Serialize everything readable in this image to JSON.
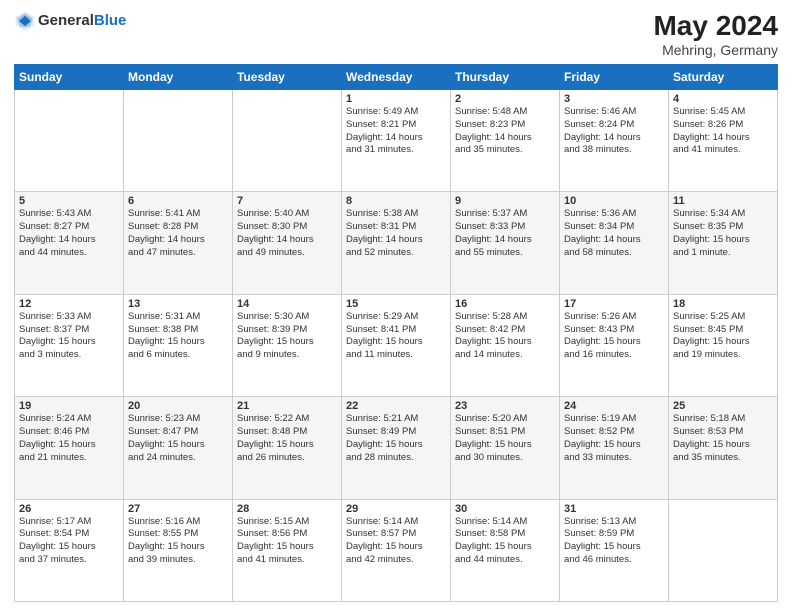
{
  "header": {
    "logo_general": "General",
    "logo_blue": "Blue",
    "month_year": "May 2024",
    "location": "Mehring, Germany"
  },
  "days_of_week": [
    "Sunday",
    "Monday",
    "Tuesday",
    "Wednesday",
    "Thursday",
    "Friday",
    "Saturday"
  ],
  "weeks": [
    [
      {
        "day": "",
        "info": ""
      },
      {
        "day": "",
        "info": ""
      },
      {
        "day": "",
        "info": ""
      },
      {
        "day": "1",
        "info": "Sunrise: 5:49 AM\nSunset: 8:21 PM\nDaylight: 14 hours\nand 31 minutes."
      },
      {
        "day": "2",
        "info": "Sunrise: 5:48 AM\nSunset: 8:23 PM\nDaylight: 14 hours\nand 35 minutes."
      },
      {
        "day": "3",
        "info": "Sunrise: 5:46 AM\nSunset: 8:24 PM\nDaylight: 14 hours\nand 38 minutes."
      },
      {
        "day": "4",
        "info": "Sunrise: 5:45 AM\nSunset: 8:26 PM\nDaylight: 14 hours\nand 41 minutes."
      }
    ],
    [
      {
        "day": "5",
        "info": "Sunrise: 5:43 AM\nSunset: 8:27 PM\nDaylight: 14 hours\nand 44 minutes."
      },
      {
        "day": "6",
        "info": "Sunrise: 5:41 AM\nSunset: 8:28 PM\nDaylight: 14 hours\nand 47 minutes."
      },
      {
        "day": "7",
        "info": "Sunrise: 5:40 AM\nSunset: 8:30 PM\nDaylight: 14 hours\nand 49 minutes."
      },
      {
        "day": "8",
        "info": "Sunrise: 5:38 AM\nSunset: 8:31 PM\nDaylight: 14 hours\nand 52 minutes."
      },
      {
        "day": "9",
        "info": "Sunrise: 5:37 AM\nSunset: 8:33 PM\nDaylight: 14 hours\nand 55 minutes."
      },
      {
        "day": "10",
        "info": "Sunrise: 5:36 AM\nSunset: 8:34 PM\nDaylight: 14 hours\nand 58 minutes."
      },
      {
        "day": "11",
        "info": "Sunrise: 5:34 AM\nSunset: 8:35 PM\nDaylight: 15 hours\nand 1 minute."
      }
    ],
    [
      {
        "day": "12",
        "info": "Sunrise: 5:33 AM\nSunset: 8:37 PM\nDaylight: 15 hours\nand 3 minutes."
      },
      {
        "day": "13",
        "info": "Sunrise: 5:31 AM\nSunset: 8:38 PM\nDaylight: 15 hours\nand 6 minutes."
      },
      {
        "day": "14",
        "info": "Sunrise: 5:30 AM\nSunset: 8:39 PM\nDaylight: 15 hours\nand 9 minutes."
      },
      {
        "day": "15",
        "info": "Sunrise: 5:29 AM\nSunset: 8:41 PM\nDaylight: 15 hours\nand 11 minutes."
      },
      {
        "day": "16",
        "info": "Sunrise: 5:28 AM\nSunset: 8:42 PM\nDaylight: 15 hours\nand 14 minutes."
      },
      {
        "day": "17",
        "info": "Sunrise: 5:26 AM\nSunset: 8:43 PM\nDaylight: 15 hours\nand 16 minutes."
      },
      {
        "day": "18",
        "info": "Sunrise: 5:25 AM\nSunset: 8:45 PM\nDaylight: 15 hours\nand 19 minutes."
      }
    ],
    [
      {
        "day": "19",
        "info": "Sunrise: 5:24 AM\nSunset: 8:46 PM\nDaylight: 15 hours\nand 21 minutes."
      },
      {
        "day": "20",
        "info": "Sunrise: 5:23 AM\nSunset: 8:47 PM\nDaylight: 15 hours\nand 24 minutes."
      },
      {
        "day": "21",
        "info": "Sunrise: 5:22 AM\nSunset: 8:48 PM\nDaylight: 15 hours\nand 26 minutes."
      },
      {
        "day": "22",
        "info": "Sunrise: 5:21 AM\nSunset: 8:49 PM\nDaylight: 15 hours\nand 28 minutes."
      },
      {
        "day": "23",
        "info": "Sunrise: 5:20 AM\nSunset: 8:51 PM\nDaylight: 15 hours\nand 30 minutes."
      },
      {
        "day": "24",
        "info": "Sunrise: 5:19 AM\nSunset: 8:52 PM\nDaylight: 15 hours\nand 33 minutes."
      },
      {
        "day": "25",
        "info": "Sunrise: 5:18 AM\nSunset: 8:53 PM\nDaylight: 15 hours\nand 35 minutes."
      }
    ],
    [
      {
        "day": "26",
        "info": "Sunrise: 5:17 AM\nSunset: 8:54 PM\nDaylight: 15 hours\nand 37 minutes."
      },
      {
        "day": "27",
        "info": "Sunrise: 5:16 AM\nSunset: 8:55 PM\nDaylight: 15 hours\nand 39 minutes."
      },
      {
        "day": "28",
        "info": "Sunrise: 5:15 AM\nSunset: 8:56 PM\nDaylight: 15 hours\nand 41 minutes."
      },
      {
        "day": "29",
        "info": "Sunrise: 5:14 AM\nSunset: 8:57 PM\nDaylight: 15 hours\nand 42 minutes."
      },
      {
        "day": "30",
        "info": "Sunrise: 5:14 AM\nSunset: 8:58 PM\nDaylight: 15 hours\nand 44 minutes."
      },
      {
        "day": "31",
        "info": "Sunrise: 5:13 AM\nSunset: 8:59 PM\nDaylight: 15 hours\nand 46 minutes."
      },
      {
        "day": "",
        "info": ""
      }
    ]
  ]
}
